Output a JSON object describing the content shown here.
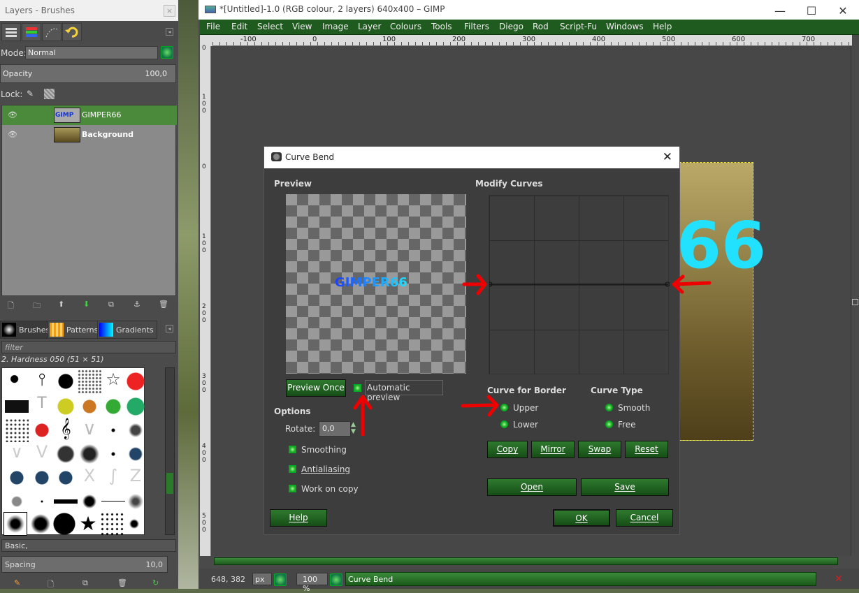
{
  "dock": {
    "title": "Layers - Brushes",
    "mode_label": "Mode:",
    "mode_value": "Normal",
    "opacity_label": "Opacity",
    "opacity_value": "100,0",
    "lock_label": "Lock:",
    "layers": [
      {
        "name": "GIMPER66",
        "selected": true
      },
      {
        "name": "Background",
        "selected": false
      }
    ],
    "brush_tabs": [
      "Brushes",
      "Patterns",
      "Gradients"
    ],
    "filter_placeholder": "filter",
    "brush_name": "2. Hardness 050 (51 × 51)",
    "preset": "Basic,",
    "spacing_label": "Spacing",
    "spacing_value": "10,0"
  },
  "window": {
    "title": "*[Untitled]-1.0 (RGB colour, 2 layers) 640x400 – GIMP",
    "menus": [
      "File",
      "Edit",
      "Select",
      "View",
      "Image",
      "Layer",
      "Colours",
      "Tools",
      "Filters",
      "Diego",
      "Rod",
      "Script-Fu",
      "Windows",
      "Help"
    ],
    "ruler_h": [
      "-100",
      "0",
      "100",
      "200",
      "300",
      "400",
      "500",
      "600",
      "700"
    ],
    "ruler_v": [
      "0",
      "1 0 0",
      "0",
      "1 0 0",
      "2 0 0",
      "3 0 0",
      "4 0 0",
      "5 0 0"
    ],
    "image_text": "66",
    "status": {
      "coords": "648, 382",
      "unit": "px",
      "zoom": "100 %",
      "message": "Curve Bend"
    }
  },
  "dialog": {
    "title": "Curve Bend",
    "preview_header": "Preview",
    "preview_text": "GIMPER66",
    "modify_header": "Modify Curves",
    "preview_once": "Preview Once",
    "auto_preview": "Automatic preview",
    "options_header": "Options",
    "rotate_label": "Rotate:",
    "rotate_value": "0,0",
    "smoothing": "Smoothing",
    "antialiasing": "Antialiasing",
    "work_on_copy": "Work on copy",
    "border_header": "Curve for Border",
    "upper": "Upper",
    "lower": "Lower",
    "type_header": "Curve Type",
    "smooth": "Smooth",
    "free": "Free",
    "copy": "Copy",
    "mirror": "Mirror",
    "swap": "Swap",
    "reset": "Reset",
    "open": "Open",
    "save": "Save",
    "help": "Help",
    "ok": "OK",
    "cancel": "Cancel"
  },
  "colors": {
    "menu_green": "#1f5a1f",
    "button_green": "#2f7a2f",
    "layer_selected": "#4a8a3a",
    "annotation_red": "#e00000",
    "text_cyan": "#22e1ff",
    "text_blue": "#1a3dff"
  }
}
